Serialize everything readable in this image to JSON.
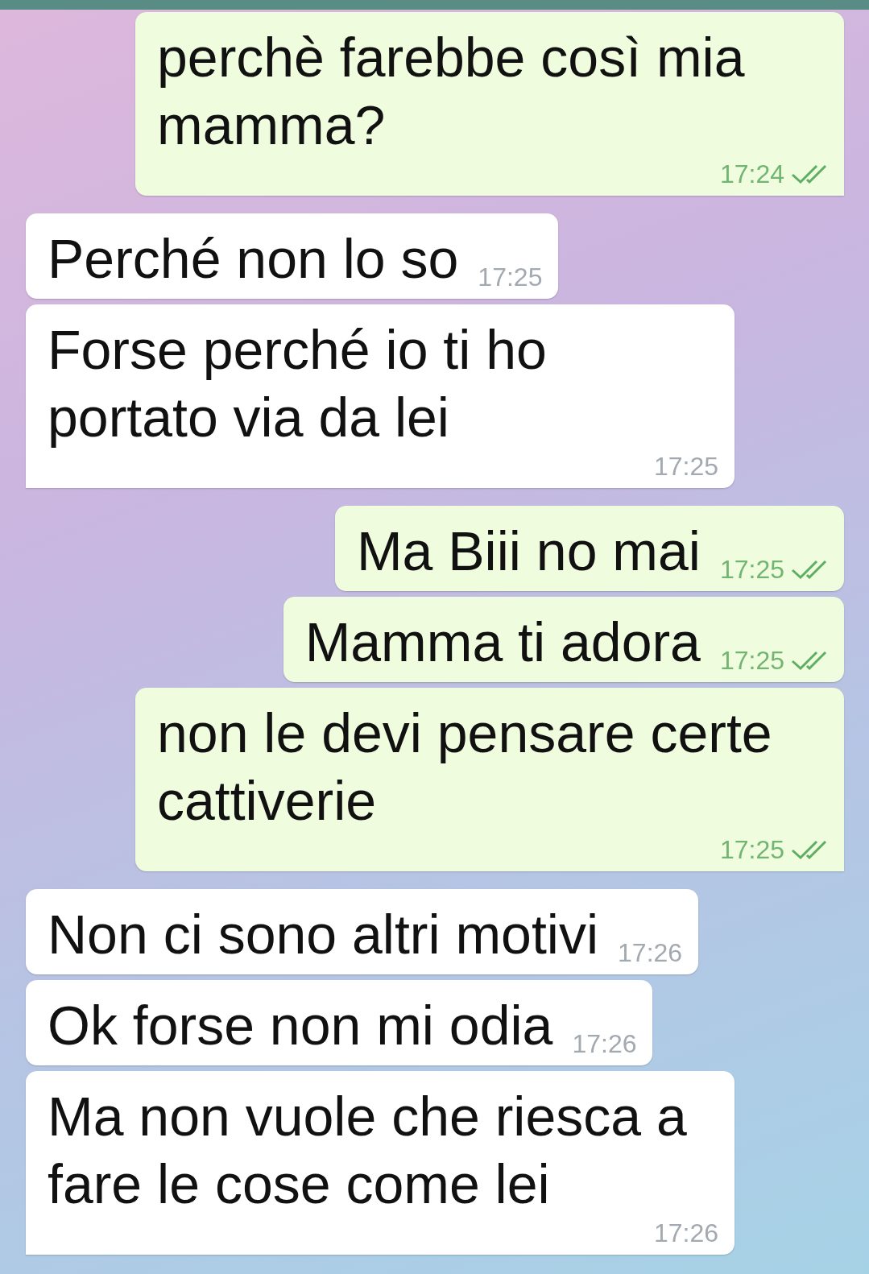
{
  "messages": [
    {
      "outgoing": true,
      "text": "perchè farebbe così mia mamma?",
      "time": "17:24",
      "read": true,
      "tail": true
    },
    {
      "outgoing": false,
      "text": "Perché non lo so",
      "time": "17:25",
      "tail": false
    },
    {
      "outgoing": false,
      "text": "Forse perché io ti ho portato via da lei",
      "time": "17:25",
      "tail": true
    },
    {
      "outgoing": true,
      "text": "Ma Biii no mai",
      "time": "17:25",
      "read": true,
      "tail": false
    },
    {
      "outgoing": true,
      "text": "Mamma ti adora",
      "time": "17:25",
      "read": true,
      "tail": false
    },
    {
      "outgoing": true,
      "text": "non le devi pensare certe cattiverie",
      "time": "17:25",
      "read": true,
      "tail": true
    },
    {
      "outgoing": false,
      "text": "Non ci sono altri motivi",
      "time": "17:26",
      "tail": false
    },
    {
      "outgoing": false,
      "text": "Ok forse non mi odia",
      "time": "17:26",
      "tail": false
    },
    {
      "outgoing": false,
      "text": "Ma non vuole che riesca a fare le cose come lei",
      "time": "17:26",
      "tail": true
    }
  ]
}
